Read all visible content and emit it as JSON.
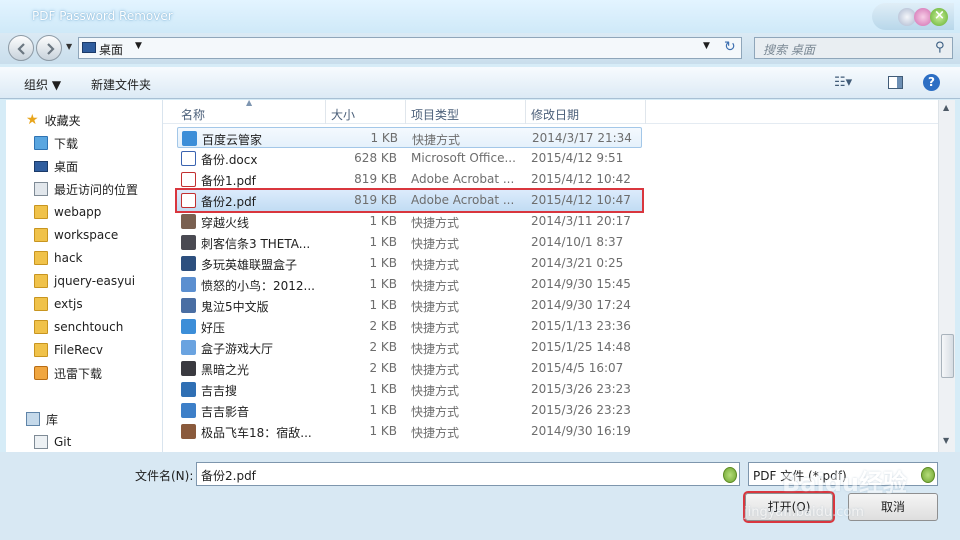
{
  "window": {
    "title": "PDF Password Remover"
  },
  "address": {
    "location": "桌面",
    "search_placeholder": "搜索 桌面"
  },
  "toolbar": {
    "organize": "组织 ▼",
    "new_folder": "新建文件夹"
  },
  "nav": {
    "favorites": "收藏夹",
    "items": [
      "下载",
      "桌面",
      "最近访问的位置",
      "webapp",
      "workspace",
      "hack",
      "jquery-easyui",
      "extjs",
      "senchtouch",
      "FileRecv",
      "迅雷下载"
    ],
    "library": "库",
    "library_items": [
      "Git"
    ]
  },
  "columns": {
    "name": "名称",
    "size": "大小",
    "type": "项目类型",
    "date": "修改日期"
  },
  "files": [
    {
      "name": "百度云管家",
      "size": "1 KB",
      "type": "快捷方式",
      "date": "2014/3/17 21:34",
      "icon": "cloud-app-icon"
    },
    {
      "name": "备份.docx",
      "size": "628 KB",
      "type": "Microsoft Office...",
      "date": "2015/4/12 9:51",
      "icon": "word-doc-icon"
    },
    {
      "name": "备份1.pdf",
      "size": "819 KB",
      "type": "Adobe Acrobat ...",
      "date": "2015/4/12 10:42",
      "icon": "pdf-icon"
    },
    {
      "name": "备份2.pdf",
      "size": "819 KB",
      "type": "Adobe Acrobat ...",
      "date": "2015/4/12 10:47",
      "icon": "pdf-icon"
    },
    {
      "name": "穿越火线",
      "size": "1 KB",
      "type": "快捷方式",
      "date": "2014/3/11 20:17",
      "icon": "game-shortcut-icon"
    },
    {
      "name": "刺客信条3 THETA...",
      "size": "1 KB",
      "type": "快捷方式",
      "date": "2014/10/1 8:37",
      "icon": "game-shortcut-icon"
    },
    {
      "name": "多玩英雄联盟盒子",
      "size": "1 KB",
      "type": "快捷方式",
      "date": "2014/3/21 0:25",
      "icon": "game-shortcut-icon"
    },
    {
      "name": "愤怒的小鸟：2012...",
      "size": "1 KB",
      "type": "快捷方式",
      "date": "2014/9/30 15:45",
      "icon": "game-shortcut-icon"
    },
    {
      "name": "鬼泣5中文版",
      "size": "1 KB",
      "type": "快捷方式",
      "date": "2014/9/30 17:24",
      "icon": "game-shortcut-icon"
    },
    {
      "name": "好压",
      "size": "2 KB",
      "type": "快捷方式",
      "date": "2015/1/13 23:36",
      "icon": "app-shortcut-icon"
    },
    {
      "name": "盒子游戏大厅",
      "size": "2 KB",
      "type": "快捷方式",
      "date": "2015/1/25 14:48",
      "icon": "app-shortcut-icon"
    },
    {
      "name": "黑暗之光",
      "size": "2 KB",
      "type": "快捷方式",
      "date": "2015/4/5 16:07",
      "icon": "game-shortcut-icon"
    },
    {
      "name": "吉吉搜",
      "size": "1 KB",
      "type": "快捷方式",
      "date": "2015/3/26 23:23",
      "icon": "app-shortcut-icon"
    },
    {
      "name": "吉吉影音",
      "size": "1 KB",
      "type": "快捷方式",
      "date": "2015/3/26 23:23",
      "icon": "app-shortcut-icon"
    },
    {
      "name": "极品飞车18：宿敌...",
      "size": "1 KB",
      "type": "快捷方式",
      "date": "2014/9/30 16:19",
      "icon": "game-shortcut-icon"
    }
  ],
  "bottom": {
    "filename_label": "文件名(N):",
    "filename_value": "备份2.pdf",
    "filetype_value": "PDF 文件 (*.pdf)",
    "open_label": "打开(O)",
    "cancel_label": "取消"
  },
  "watermark": {
    "text": "Baidu经验",
    "url": "jingyan.baidu.com"
  }
}
